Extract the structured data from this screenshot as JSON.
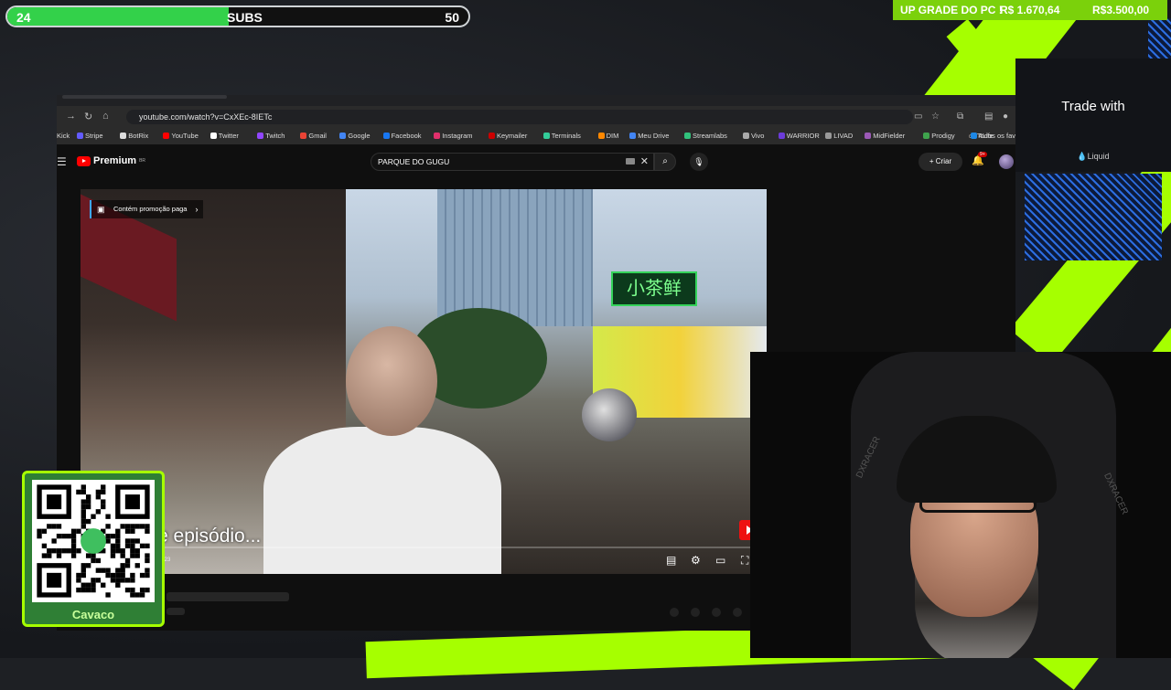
{
  "colors": {
    "accent_green": "#a6ff00",
    "subs_fill": "#33d14a",
    "youtube_red": "#ff0000"
  },
  "subs_goal": {
    "current": "24",
    "label": "SUBS",
    "goal": "50",
    "progress_fraction": 0.48
  },
  "upgrade_goal": {
    "label": "UP GRADE DO PC !",
    "current": "R$ 1.670,64",
    "target": "R$3.500,00"
  },
  "sponsor_panel": {
    "title": "Trade with",
    "brand": "Liquid"
  },
  "browser": {
    "url": "youtube.com/watch?v=CxXEc-8IETc",
    "bookmarks": [
      "Kick",
      "Stripe",
      "BotRix",
      "YouTube",
      "Twitter",
      "Twitch",
      "Gmail",
      "Google",
      "Facebook",
      "Instagram",
      "Keymailer",
      "Terminals",
      "DIM",
      "Meu Drive",
      "Streamlabs",
      "Vivo",
      "WARRIOR",
      "LIVAD",
      "MidFielder",
      "Prodigy",
      "4Life"
    ],
    "bookmarks_folder": "Todos os fav"
  },
  "youtube": {
    "logo_text": "Premium",
    "logo_region": "BR",
    "search_query": "PARQUE DO GUGU",
    "create_label": "Criar",
    "notification_count": "9+"
  },
  "video": {
    "promo_label": "Contém promoção paga",
    "caption": "e episódio...",
    "time": ":23",
    "shop_sign": "小茶鲜"
  },
  "qr": {
    "label": "Cavaco"
  },
  "webcam": {
    "chair_brand": "DXRACER"
  }
}
